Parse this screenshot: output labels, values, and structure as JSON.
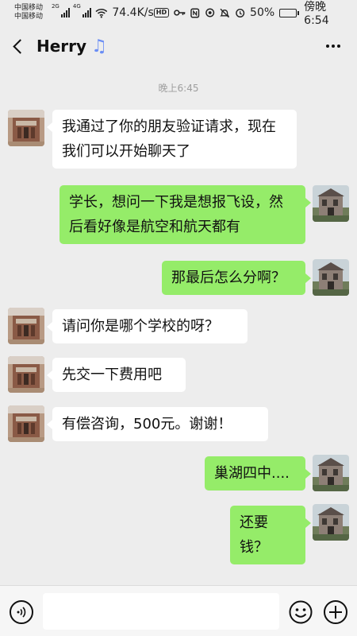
{
  "status_bar": {
    "carrier_1": "中国移动",
    "carrier_2": "中国移动",
    "network_1": "2G",
    "network_2": "4G",
    "net_speed": "74.4K/s",
    "hd_badge": "HD",
    "battery": "50%",
    "battery_level": 0.5,
    "time": "傍晚6:54"
  },
  "header": {
    "back_icon": "chevron-left-icon",
    "title": "Herry",
    "title_icon": "music-note-icon",
    "more_icon": "more-dots-icon"
  },
  "chat": {
    "timestamp": "晚上6:45",
    "messages": [
      {
        "side": "left",
        "text": "我通过了你的朋友验证请求，现在我们可以开始聊天了"
      },
      {
        "side": "right",
        "text": "学长，想问一下我是想报飞设，然后看好像是航空和航天都有"
      },
      {
        "side": "right",
        "text": "那最后怎么分啊？"
      },
      {
        "side": "left",
        "text": "请问你是哪个学校的呀？"
      },
      {
        "side": "left",
        "text": "先交一下费用吧"
      },
      {
        "side": "left",
        "text": "有偿咨询，500元。谢谢！"
      },
      {
        "side": "right",
        "text": "巢湖四中...."
      },
      {
        "side": "right",
        "text": "还要钱？"
      }
    ]
  },
  "input_bar": {
    "voice_icon": "voice-icon",
    "input_value": "",
    "emoji_icon": "emoji-icon",
    "plus_icon": "plus-icon"
  },
  "colors": {
    "background": "#ededed",
    "sent_bubble": "#95ec69",
    "received_bubble": "#ffffff",
    "title_icon": "#6b8ef5"
  }
}
